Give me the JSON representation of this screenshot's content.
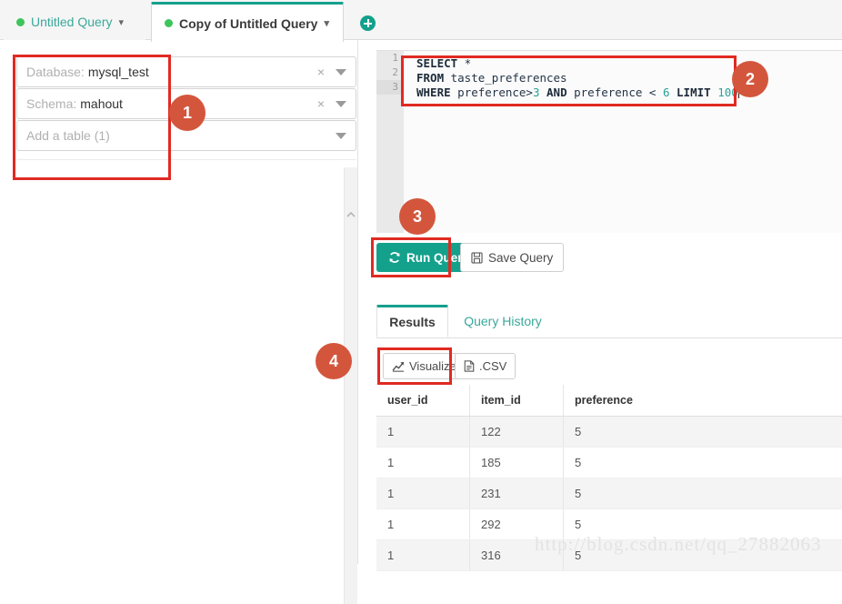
{
  "tabs": {
    "inactive": {
      "label": "Untitled Query",
      "status_dot": "green-dot",
      "caret": "chevron-down-icon"
    },
    "active": {
      "label": "Copy of Untitled Query",
      "status_dot": "green-dot",
      "caret": "chevron-down-icon"
    },
    "add_tab_icon": "plus-circle-icon"
  },
  "sidebar": {
    "database": {
      "prefix": "Database:",
      "value": "mysql_test",
      "clear_icon": "close-icon",
      "arrow_icon": "caret-down-icon"
    },
    "schema": {
      "prefix": "Schema:",
      "value": "mahout",
      "clear_icon": "close-icon",
      "arrow_icon": "caret-down-icon"
    },
    "table": {
      "placeholder": "Add a table (1)",
      "arrow_icon": "caret-down-icon"
    },
    "scroll_up_icon": "chevron-up-icon"
  },
  "editor": {
    "line_numbers": [
      "1",
      "2",
      "3"
    ],
    "lines": [
      [
        {
          "t": "SELECT",
          "c": "kw"
        },
        {
          "t": " *",
          "c": "ident"
        }
      ],
      [
        {
          "t": "FROM",
          "c": "kw"
        },
        {
          "t": " taste_preferences",
          "c": "ident"
        }
      ],
      [
        {
          "t": "WHERE",
          "c": "kw"
        },
        {
          "t": " preference>",
          "c": "ident"
        },
        {
          "t": "3",
          "c": "num"
        },
        {
          "t": " ",
          "c": "ident"
        },
        {
          "t": "AND",
          "c": "kw"
        },
        {
          "t": " preference < ",
          "c": "ident"
        },
        {
          "t": "6",
          "c": "num"
        },
        {
          "t": " ",
          "c": "ident"
        },
        {
          "t": "LIMIT",
          "c": "kw"
        },
        {
          "t": " ",
          "c": "ident"
        },
        {
          "t": "100",
          "c": "num"
        }
      ]
    ],
    "full_text": "SELECT *\nFROM taste_preferences\nWHERE preference>3 AND preference < 6 LIMIT 100",
    "active_line": 3
  },
  "actions": {
    "run_query": {
      "label": "Run Query",
      "icon": "refresh-icon",
      "color": "#13a18c"
    },
    "save_query": {
      "label": "Save Query",
      "icon": "floppy-disk-icon"
    }
  },
  "result_tabs": {
    "results": {
      "label": "Results",
      "active": true
    },
    "history": {
      "label": "Query History",
      "active": false
    },
    "accent_color": "#15a08c"
  },
  "export": {
    "visualize": {
      "label": "Visualize",
      "icon": "chart-line-icon"
    },
    "csv": {
      "label": ".CSV",
      "icon": "file-icon"
    }
  },
  "results_table": {
    "columns": [
      "user_id",
      "item_id",
      "preference"
    ],
    "rows": [
      [
        "1",
        "122",
        "5"
      ],
      [
        "1",
        "185",
        "5"
      ],
      [
        "1",
        "231",
        "5"
      ],
      [
        "1",
        "292",
        "5"
      ],
      [
        "1",
        "316",
        "5"
      ]
    ]
  },
  "watermark": {
    "text": "http://blog.csdn.net/qq_27882063"
  },
  "annotations": {
    "marker_color": "#d3563c",
    "box_color": "#e02a22",
    "markers": [
      {
        "number": "1"
      },
      {
        "number": "2"
      },
      {
        "number": "3"
      },
      {
        "number": "4"
      }
    ]
  }
}
